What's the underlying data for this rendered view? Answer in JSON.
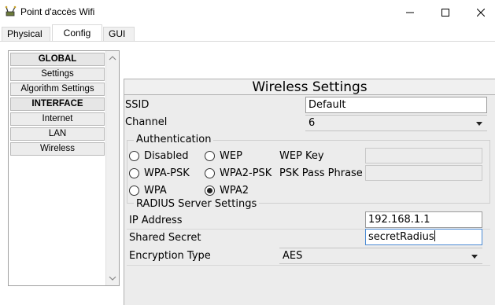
{
  "window": {
    "title": "Point d'accès Wifi",
    "icon": "access-point-icon",
    "controls": {
      "minimize_icon": "minimize-icon",
      "maximize_icon": "maximize-icon",
      "close_icon": "close-icon"
    }
  },
  "tabs": [
    {
      "label": "Physical",
      "active": false
    },
    {
      "label": "Config",
      "active": true
    },
    {
      "label": "GUI",
      "active": false
    }
  ],
  "nav": {
    "items": [
      {
        "label": "GLOBAL",
        "header": true
      },
      {
        "label": "Settings",
        "header": false
      },
      {
        "label": "Algorithm Settings",
        "header": false
      },
      {
        "label": "INTERFACE",
        "header": true
      },
      {
        "label": "Internet",
        "header": false
      },
      {
        "label": "LAN",
        "header": false
      },
      {
        "label": "Wireless",
        "header": false
      }
    ]
  },
  "wireless": {
    "title": "Wireless Settings",
    "ssid_label": "SSID",
    "ssid_value": "Default",
    "channel_label": "Channel",
    "channel_value": "6",
    "auth_legend": "Authentication",
    "auth_options": {
      "disabled": "Disabled",
      "wep": "WEP",
      "wpa_psk": "WPA-PSK",
      "wpa2_psk": "WPA2-PSK",
      "wpa": "WPA",
      "wpa2": "WPA2"
    },
    "auth_selected": "WPA2",
    "wep_key_label": "WEP Key",
    "psk_label": "PSK Pass Phrase",
    "radius_legend": "RADIUS Server Settings",
    "ip_label": "IP Address",
    "ip_value": "192.168.1.1",
    "secret_label": "Shared Secret",
    "secret_value": "secretRadius",
    "encryption_label": "Encryption Type",
    "encryption_value": "AES"
  },
  "colors": {
    "focus_border": "#4a8ad4",
    "panel_bg": "#ececec"
  }
}
